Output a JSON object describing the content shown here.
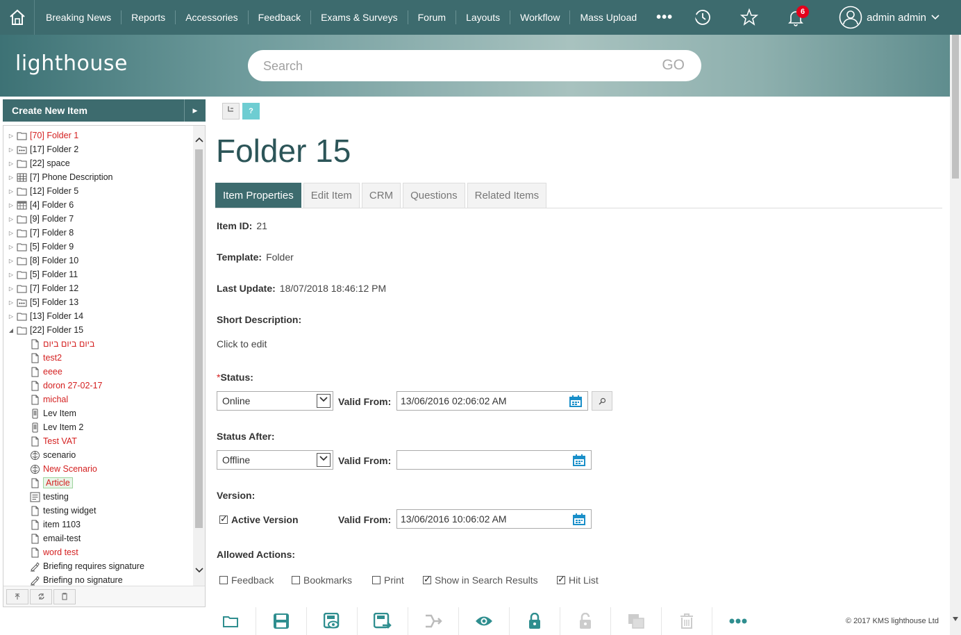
{
  "nav": {
    "items": [
      "Breaking News",
      "Reports",
      "Accessories",
      "Feedback",
      "Exams & Surveys",
      "Forum",
      "Layouts",
      "Workflow",
      "Mass Upload"
    ],
    "more": "•••",
    "notifications_count": "6",
    "user_name": "admin admin"
  },
  "banner": {
    "logo": "lighthouse",
    "search_placeholder": "Search",
    "go_label": "GO"
  },
  "sidebar": {
    "create_label": "Create New Item",
    "tree": [
      {
        "label": "[70] Folder 1",
        "red": true,
        "icon": "folder",
        "level": 0
      },
      {
        "label": "[17] Folder 2",
        "red": false,
        "icon": "folder-dots",
        "level": 0
      },
      {
        "label": "[22] space",
        "red": false,
        "icon": "folder",
        "level": 0
      },
      {
        "label": "[7] Phone Description",
        "red": false,
        "icon": "grid",
        "level": 0
      },
      {
        "label": "[12] Folder 5",
        "red": false,
        "icon": "folder",
        "level": 0
      },
      {
        "label": "[4] Folder 6",
        "red": false,
        "icon": "calendar",
        "level": 0
      },
      {
        "label": "[9] Folder 7",
        "red": false,
        "icon": "folder",
        "level": 0
      },
      {
        "label": "[7] Folder 8",
        "red": false,
        "icon": "folder",
        "level": 0
      },
      {
        "label": "[5] Folder 9",
        "red": false,
        "icon": "folder",
        "level": 0
      },
      {
        "label": "[8] Folder 10",
        "red": false,
        "icon": "folder",
        "level": 0
      },
      {
        "label": "[5] Folder 11",
        "red": false,
        "icon": "folder",
        "level": 0
      },
      {
        "label": "[7] Folder 12",
        "red": false,
        "icon": "folder",
        "level": 0
      },
      {
        "label": "[5] Folder 13",
        "red": false,
        "icon": "folder-dots",
        "level": 0
      },
      {
        "label": "[13] Folder 14",
        "red": false,
        "icon": "folder",
        "level": 0
      },
      {
        "label": "[22] Folder 15",
        "red": false,
        "icon": "folder",
        "level": 0,
        "expanded": true
      },
      {
        "label": "ביום ביום ביום",
        "red": true,
        "icon": "doc",
        "level": 1
      },
      {
        "label": "test2",
        "red": true,
        "icon": "doc",
        "level": 1
      },
      {
        "label": "eeee",
        "red": true,
        "icon": "doc",
        "level": 1
      },
      {
        "label": "doron 27-02-17",
        "red": true,
        "icon": "doc",
        "level": 1
      },
      {
        "label": "michal",
        "red": true,
        "icon": "doc",
        "level": 1
      },
      {
        "label": "Lev Item",
        "red": false,
        "icon": "phone",
        "level": 1
      },
      {
        "label": "Lev Item 2",
        "red": false,
        "icon": "phone",
        "level": 1
      },
      {
        "label": "Test VAT",
        "red": true,
        "icon": "doc",
        "level": 1
      },
      {
        "label": "scenario",
        "red": false,
        "icon": "brain",
        "level": 1
      },
      {
        "label": "New Scenario",
        "red": true,
        "icon": "brain",
        "level": 1
      },
      {
        "label": "Article",
        "red": true,
        "icon": "doc",
        "level": 1,
        "selected": true
      },
      {
        "label": "testing",
        "red": false,
        "icon": "list",
        "level": 1
      },
      {
        "label": "testing widget",
        "red": false,
        "icon": "doc",
        "level": 1
      },
      {
        "label": "item 1103",
        "red": false,
        "icon": "doc",
        "level": 1
      },
      {
        "label": "email-test",
        "red": false,
        "icon": "doc",
        "level": 1
      },
      {
        "label": "word test",
        "red": true,
        "icon": "doc",
        "level": 1
      },
      {
        "label": "Briefing requires signature",
        "red": false,
        "icon": "sign",
        "level": 1
      },
      {
        "label": "Briefing no signature",
        "red": false,
        "icon": "sign",
        "level": 1
      }
    ]
  },
  "main": {
    "help_label": "?",
    "title": "Folder 15",
    "tabs": [
      "Item Properties",
      "Edit Item",
      "CRM",
      "Questions",
      "Related Items"
    ],
    "item_id_label": "Item ID:",
    "item_id": "21",
    "template_label": "Template:",
    "template": "Folder",
    "last_update_label": "Last Update:",
    "last_update": "18/07/2018 18:46:12 PM",
    "short_desc_label": "Short Description:",
    "short_desc": "Click to edit",
    "status_req": "*",
    "status_label": "Status:",
    "status_value": "Online",
    "valid_from_label": "Valid From:",
    "status_valid_from": "13/06/2016 02:06:02 AM",
    "status_after_label": "Status After:",
    "status_after_value": "Offline",
    "status_after_valid_from": "",
    "version_label": "Version:",
    "active_version_label": "Active Version",
    "version_valid_from": "13/06/2016 10:06:02 AM",
    "allowed_actions_label": "Allowed Actions:",
    "actions": [
      {
        "label": "Feedback",
        "checked": false
      },
      {
        "label": "Bookmarks",
        "checked": false
      },
      {
        "label": "Print",
        "checked": false
      },
      {
        "label": "Show in Search Results",
        "checked": true
      },
      {
        "label": "Hit List",
        "checked": true
      }
    ]
  },
  "footer": {
    "copyright": "© 2017 KMS lighthouse Ltd"
  },
  "colors": {
    "brand": "#3d6b6e",
    "accent_teal": "#2f8e8f",
    "red_item": "#d42020",
    "calendar_blue": "#1a8fc9"
  }
}
